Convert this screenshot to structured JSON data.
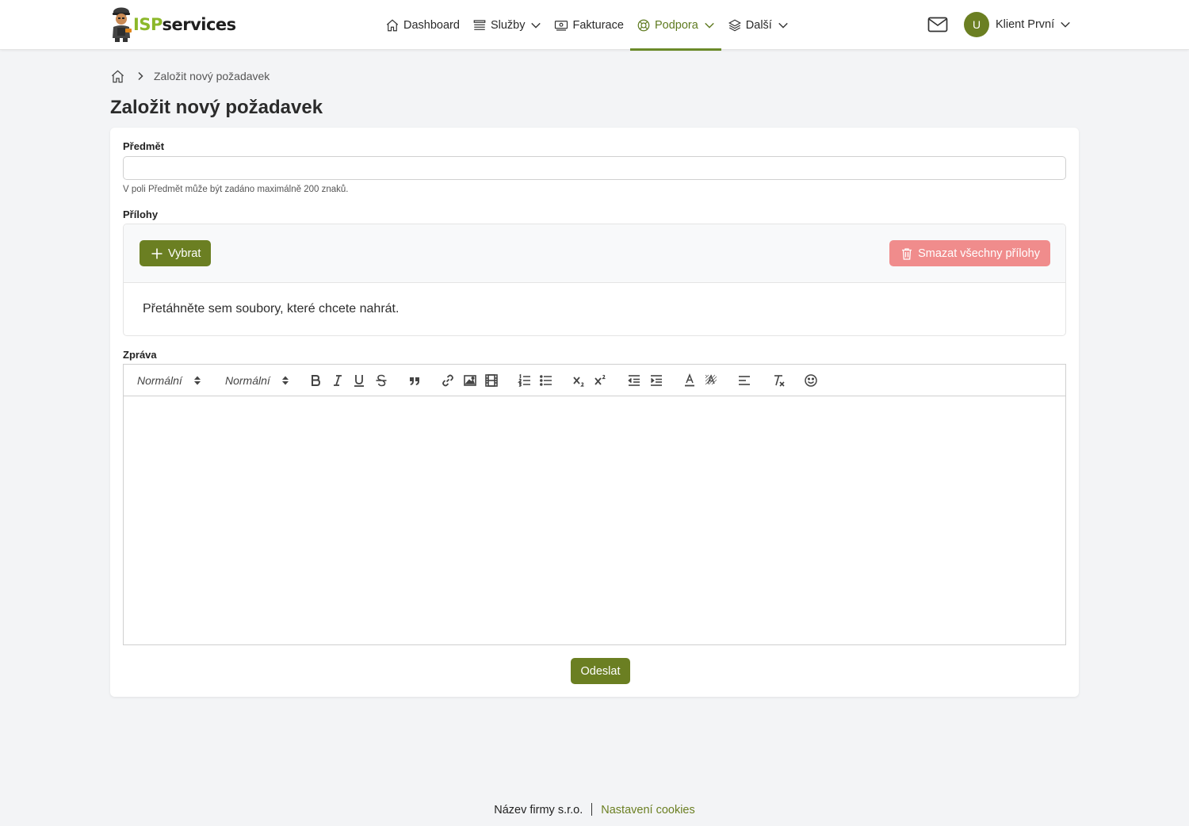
{
  "header": {
    "logo": {
      "part1": "ISP",
      "part2": "services"
    },
    "nav": [
      {
        "label": "Dashboard",
        "icon": "home-icon"
      },
      {
        "label": "Služby",
        "icon": "list-icon",
        "dropdown": true
      },
      {
        "label": "Fakturace",
        "icon": "invoice-icon"
      },
      {
        "label": "Podpora",
        "icon": "lifebuoy-icon",
        "dropdown": true,
        "active": true
      },
      {
        "label": "Další",
        "icon": "layers-icon",
        "dropdown": true
      }
    ],
    "user": {
      "initial": "U",
      "name": "Klient První"
    }
  },
  "breadcrumb": {
    "current": "Založit nový požadavek"
  },
  "page_title": "Založit nový požadavek",
  "form": {
    "subject_label": "Předmět",
    "subject_value": "",
    "subject_hint": "V poli Předmět může být zadáno maximálně 200 znaků.",
    "attachments_label": "Přílohy",
    "pick_label": "Vybrat",
    "clear_label": "Smazat všechny přílohy",
    "drop_text": "Přetáhněte sem soubory, které chcete nahrát.",
    "message_label": "Zpráva",
    "toolbar": {
      "font_select": "Normální",
      "size_select": "Normální"
    },
    "submit_label": "Odeslat"
  },
  "footer": {
    "company": "Název firmy s.r.o.",
    "cookies": "Nastavení cookies"
  },
  "colors": {
    "accent": "#6b7f22",
    "danger": "#f08c8c",
    "logo_green": "#8cb82a"
  }
}
